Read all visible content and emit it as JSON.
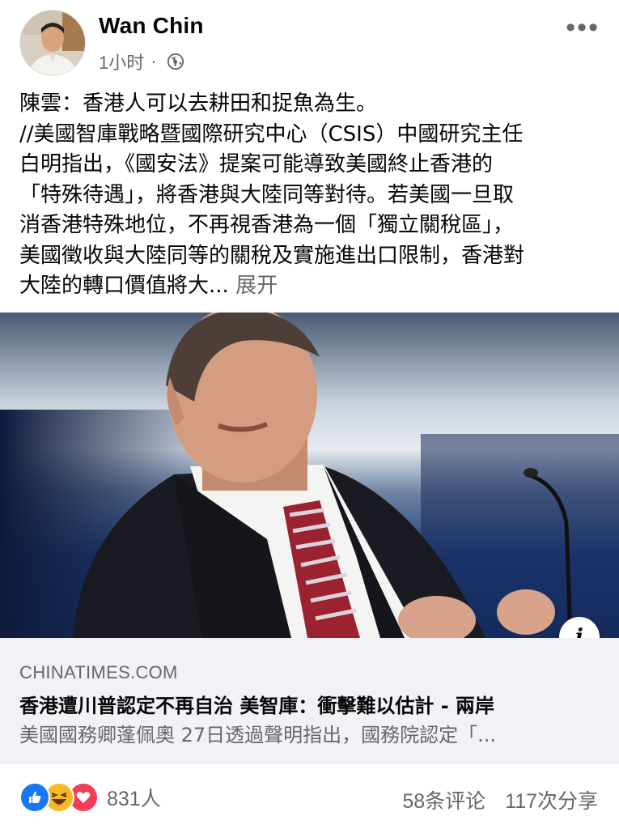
{
  "post": {
    "author": "Wan Chin",
    "time": "1小时",
    "separator": "·",
    "body_lines": [
      "陳雲：香港人可以去耕田和捉魚為生。",
      "//美國智庫戰略暨國際研究中心（CSIS）中國研究主任",
      "白明指出，《國安法》提案可能導致美國終止香港的",
      "「特殊待遇」，將香港與大陸同等對待。若美國一旦取",
      "消香港特殊地位，不再視香港為一個「獨立關稅區」，",
      "美國徵收與大陸同等的關稅及實施進出口限制，香港對",
      "大陸的轉口價值將大..."
    ],
    "see_more": "展开"
  },
  "link_preview": {
    "domain": "CHINATIMES.COM",
    "title": "香港遭川普認定不再自治 美智庫：衝擊難以估計 - 兩岸",
    "description": "美國國務卿蓬佩奧 27日透過聲明指出，國務院認定「..."
  },
  "footer": {
    "reaction_count": "831人",
    "comments": "58条评论",
    "shares": "117次分享"
  },
  "icons": {
    "more": "more-options-icon",
    "globe": "globe-icon",
    "info": "info-icon",
    "like": "like-reaction-icon",
    "haha": "haha-reaction-icon",
    "love": "love-reaction-icon"
  },
  "colors": {
    "like_blue": "#1877f2",
    "love_red": "#f33e58",
    "haha_yellow": "#f7b928",
    "secondary_text": "#65676b",
    "link_box_bg": "#f0f2f5"
  }
}
